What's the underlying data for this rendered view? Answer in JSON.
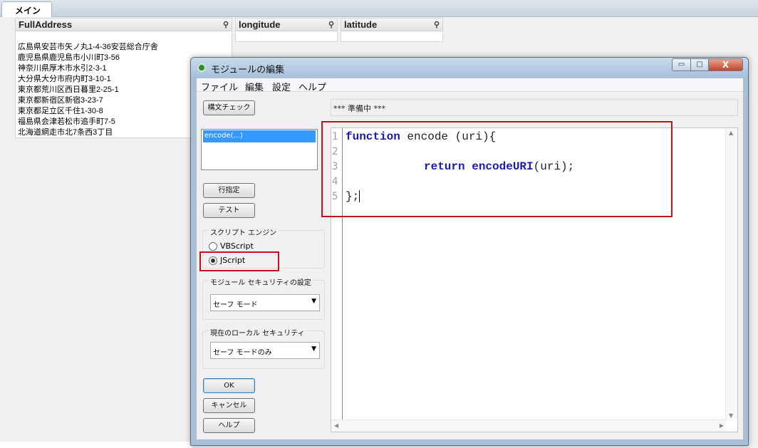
{
  "sheet": {
    "tab_main": "メイン",
    "listboxes": [
      {
        "title": "FullAddress"
      },
      {
        "title": "longitude"
      },
      {
        "title": "latitude"
      }
    ],
    "addresses": [
      "広島県安芸市矢ノ丸1-4-36安芸総合庁舎",
      "鹿児島県鹿児島市小川町3-56",
      "神奈川県厚木市水引2-3-1",
      "大分県大分市府内町3-10-1",
      "東京都荒川区西日暮里2-25-1",
      "東京都新宿区新宿3-23-7",
      "東京都足立区千住1-30-8",
      "福島県会津若松市追手町7-5",
      "北海道網走市北7条西3丁目"
    ]
  },
  "dialog": {
    "title": "モジュールの編集",
    "window_buttons": {
      "minimize": "▭",
      "maximize": "□",
      "close": "X"
    },
    "menu": [
      "ファイル",
      "編集",
      "設定",
      "ヘルプ"
    ],
    "syntax_check": "構文チェック",
    "function_list": [
      "encode(...)"
    ],
    "goto_line": "行指定",
    "test": "テスト",
    "script_engine": {
      "label": "スクリプト エンジン",
      "options": [
        "VBScript",
        "JScript"
      ],
      "selected": "JScript"
    },
    "module_security": {
      "label": "モジュール セキュリティの設定",
      "value": "セーフ モード"
    },
    "local_security": {
      "label": "現在のローカル セキュリティ",
      "value": "セーフ モードのみ"
    },
    "ok": "OK",
    "cancel": "キャンセル",
    "help": "ヘルプ",
    "status": "*** 準備中 ***",
    "line_numbers": [
      "1",
      "2",
      "3",
      "4",
      "5"
    ],
    "code": {
      "kw_function": "function",
      "line1_rest": " encode (uri){",
      "kw_return": "return",
      "kw_encodeURI": "encodeURI",
      "line3_rest": "(uri);",
      "line5": "};"
    },
    "highlight_color": "#c0111c"
  }
}
